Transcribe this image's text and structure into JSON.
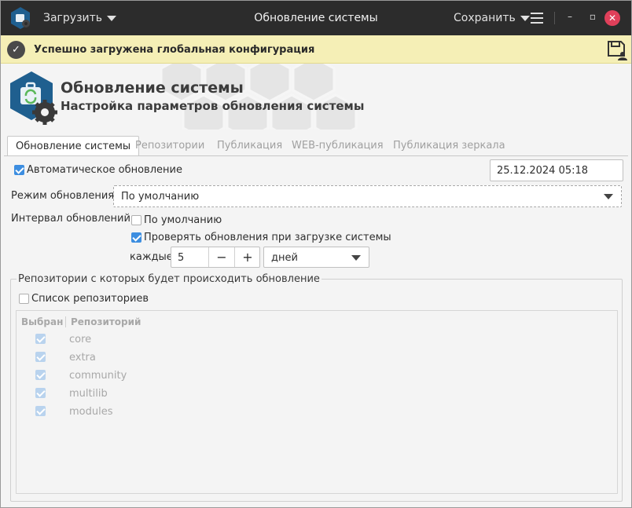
{
  "titlebar": {
    "load_label": "Загрузить",
    "title": "Обновление системы",
    "save_label": "Сохранить",
    "minimize_glyph": "–",
    "maximize_glyph": "▫",
    "close_glyph": "✕"
  },
  "notification": {
    "text": "Успешно загружена глобальная конфигурация"
  },
  "header": {
    "title": "Обновление системы",
    "subtitle": "Настройка параметров обновления системы"
  },
  "tabs": [
    {
      "label": "Обновление системы",
      "active": true
    },
    {
      "label": "Репозитории",
      "active": false
    },
    {
      "label": "Публикация",
      "active": false
    },
    {
      "label": "WEB-публикация",
      "active": false
    },
    {
      "label": "Публикация зеркала",
      "active": false
    }
  ],
  "update": {
    "auto_update_label": "Автоматическое обновление",
    "auto_update_checked": true,
    "datetime": "25.12.2024 05:18",
    "mode_label": "Режим обновления:",
    "mode_value": "По умолчанию",
    "interval_label": "Интервал обновлений:",
    "interval_default_label": "По умолчанию",
    "interval_default_checked": false,
    "check_on_boot_label": "Проверять обновления при загрузке системы",
    "check_on_boot_checked": true,
    "every_label": "каждые",
    "every_value": "5",
    "minus_glyph": "−",
    "plus_glyph": "+",
    "unit_value": "дней"
  },
  "repos_group": {
    "title": "Репозитории с которых будет происходить обновление",
    "list_label": "Список репозиториев",
    "list_checked": false,
    "columns": [
      "Выбран",
      "Репозиторий"
    ],
    "rows": [
      {
        "selected": true,
        "name": "core"
      },
      {
        "selected": true,
        "name": "extra"
      },
      {
        "selected": true,
        "name": "community"
      },
      {
        "selected": true,
        "name": "multilib"
      },
      {
        "selected": true,
        "name": "modules"
      }
    ]
  },
  "colors": {
    "titlebar_bg": "#2c2c2c",
    "notify_bg": "#f5efb6",
    "accent": "#3d8ee0",
    "close_button": "#e0405a",
    "logo_blue": "#1f5f8f"
  }
}
